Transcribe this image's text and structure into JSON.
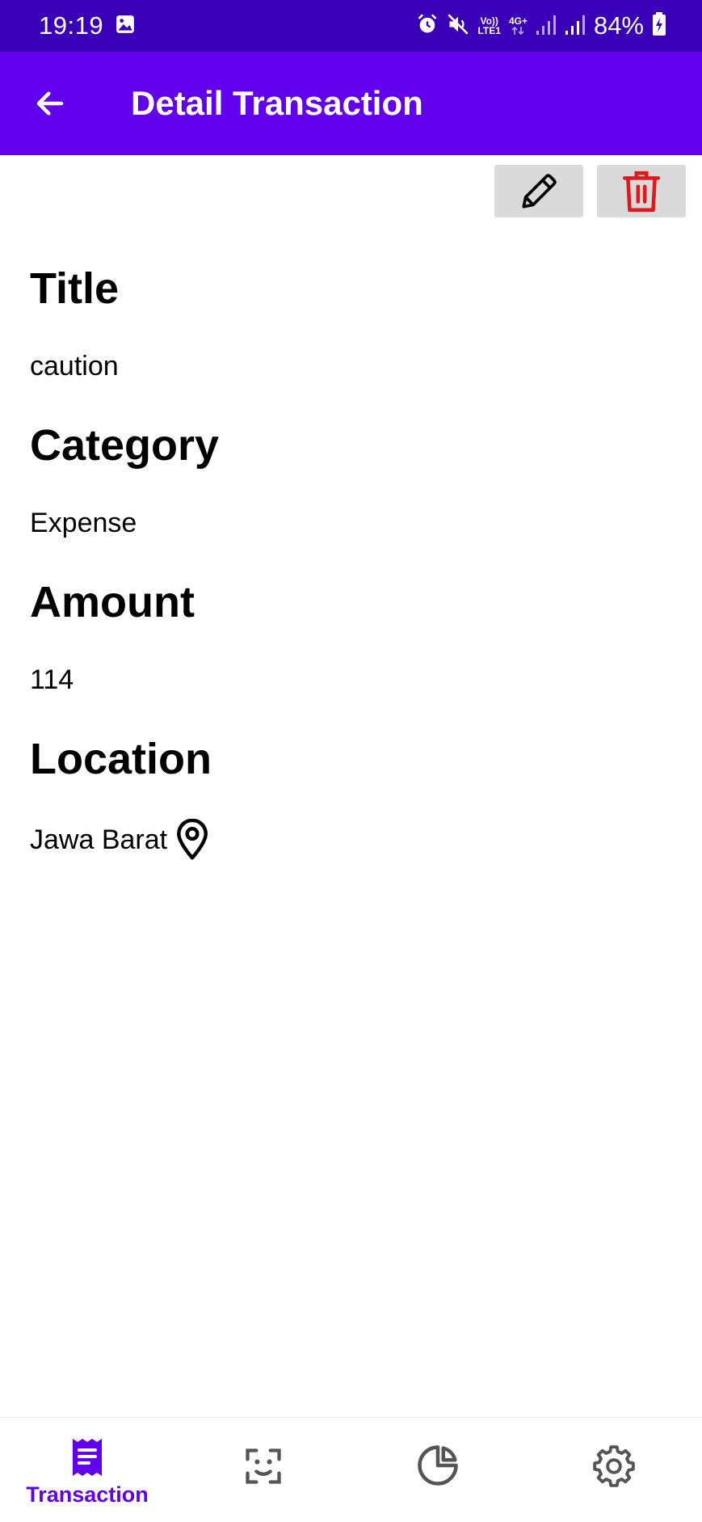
{
  "status_bar": {
    "time": "19:19",
    "volte": "Vo))",
    "lte": "LTE1",
    "network": "4G+",
    "battery": "84%",
    "icons": [
      "image-icon",
      "alarm-icon",
      "mute-icon",
      "signal-icon",
      "signal-icon",
      "battery-charging-icon"
    ]
  },
  "app_bar": {
    "title": "Detail Transaction",
    "back_icon": "arrow-back-icon"
  },
  "actions": {
    "edit_icon": "pencil-icon",
    "delete_icon": "trash-icon"
  },
  "fields": {
    "title_label": "Title",
    "title_value": "caution",
    "category_label": "Category",
    "category_value": "Expense",
    "amount_label": "Amount",
    "amount_value": "114",
    "location_label": "Location",
    "location_value": "Jawa Barat",
    "location_icon": "location-pin-icon"
  },
  "bottom_nav": {
    "items": [
      {
        "label": "Transaction",
        "icon": "receipt-icon",
        "active": true
      },
      {
        "label": "",
        "icon": "face-scan-icon",
        "active": false
      },
      {
        "label": "",
        "icon": "pie-chart-icon",
        "active": false
      },
      {
        "label": "",
        "icon": "gear-icon",
        "active": false
      }
    ]
  },
  "colors": {
    "status_bar": "#3a00b8",
    "app_bar": "#6200ee",
    "accent": "#6200ee",
    "delete": "#e0171b",
    "action_button_bg": "#dadada",
    "nav_inactive": "#555555"
  }
}
